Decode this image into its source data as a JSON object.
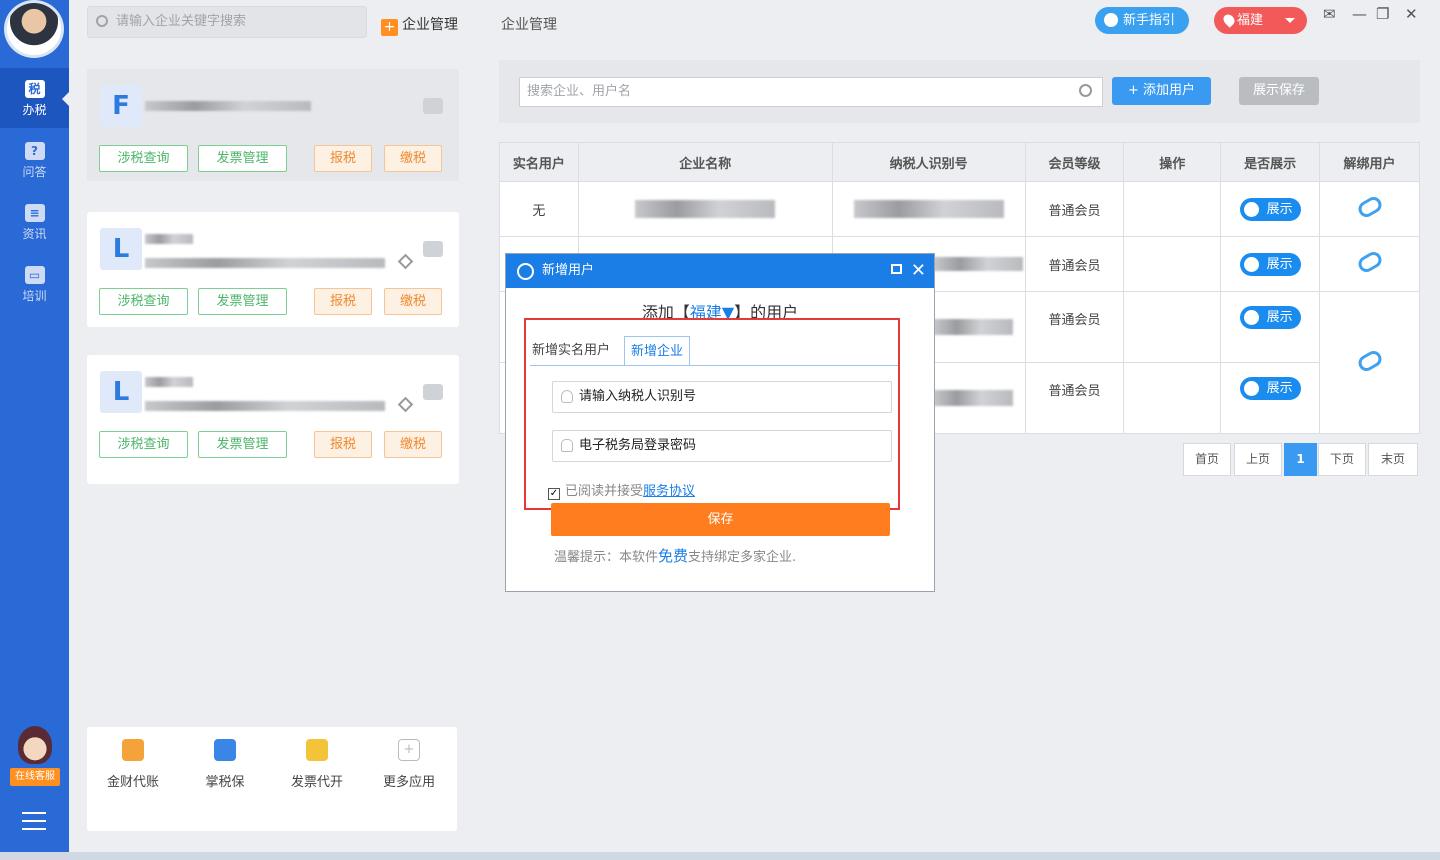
{
  "rail": {
    "items": [
      {
        "icon": "税",
        "label": "办税"
      },
      {
        "icon": "?",
        "label": "问答"
      },
      {
        "icon": "≡",
        "label": "资讯"
      },
      {
        "icon": "▭",
        "label": "培训"
      }
    ],
    "service_label": "在线客服"
  },
  "topbar": {
    "search_placeholder": "请输入企业关键字搜索",
    "tab_active": "企业管理",
    "tab_other": "企业管理",
    "guide_label": "新手指引",
    "region_label": "福建"
  },
  "companies": [
    {
      "letter": "F",
      "buttons": [
        "涉税查询",
        "发票管理",
        "报税",
        "缴税"
      ]
    },
    {
      "letter": "L",
      "buttons": [
        "涉税查询",
        "发票管理",
        "报税",
        "缴税"
      ]
    },
    {
      "letter": "L",
      "buttons": [
        "涉税查询",
        "发票管理",
        "报税",
        "缴税"
      ]
    }
  ],
  "apps": [
    {
      "label": "金财代账",
      "color": "#f4a23a"
    },
    {
      "label": "掌税保",
      "color": "#3a86e6"
    },
    {
      "label": "发票代开",
      "color": "#f3c33a"
    },
    {
      "label": "更多应用",
      "color": "#bbbbbb"
    }
  ],
  "main": {
    "search_placeholder": "搜索企业、用户名",
    "add_user_label": "+ 添加用户",
    "show_save_label": "展示保存",
    "table": {
      "headers": [
        "实名用户",
        "企业名称",
        "纳税人识别号",
        "会员等级",
        "操作",
        "是否展示",
        "解绑用户"
      ],
      "rows": [
        {
          "realname": "无",
          "level": "普通会员",
          "show": "展示"
        },
        {
          "realname": "",
          "level": "普通会员",
          "show": "展示"
        },
        {
          "realname": "",
          "level": "普通会员",
          "show": "展示"
        },
        {
          "realname": "",
          "level": "普通会员",
          "show": "展示"
        }
      ]
    },
    "pager": [
      "首页",
      "上页",
      "1",
      "下页",
      "末页"
    ]
  },
  "dialog": {
    "title": "新增用户",
    "heading_prefix": "添加【",
    "heading_region": "福建▼",
    "heading_suffix": "】的用户",
    "tab_realname": "新增实名用户",
    "tab_company": "新增企业",
    "taxid_value": "请输入纳税人识别号",
    "password_value": "电子税务局登录密码",
    "agree_text": "已阅读并接受",
    "agree_link": "服务协议",
    "save_label": "保存",
    "tip_prefix": "温馨提示：本软件",
    "tip_free": "免费",
    "tip_suffix": "支持绑定多家企业."
  }
}
